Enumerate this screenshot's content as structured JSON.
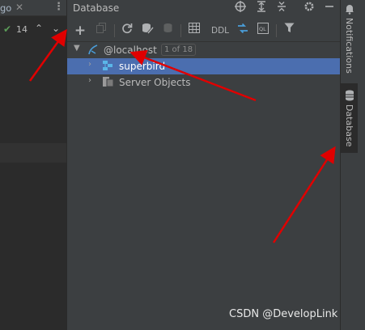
{
  "left_panel": {
    "tab_fragment": "go",
    "close_glyph": "✕",
    "menu_glyph": "⋮",
    "checks_glyph": "✔",
    "problem_count": "14",
    "up_glyph": "⌃",
    "down_glyph": "⌄"
  },
  "database_panel": {
    "title": "Database",
    "header_buttons": [
      "crosshair-icon",
      "expand-all-icon",
      "collapse-all-icon",
      "gear-icon",
      "minimize-icon"
    ],
    "toolbar": {
      "add_glyph": "+",
      "ddl_label": "DDL"
    },
    "tree": [
      {
        "label": "@localhost",
        "badge": "1 of 18",
        "expanded": true,
        "depth": 0,
        "icon": "datasource-icon"
      },
      {
        "label": "superbird",
        "expanded": false,
        "depth": 1,
        "selected": true,
        "icon": "schema-icon"
      },
      {
        "label": "Server Objects",
        "expanded": false,
        "depth": 1,
        "icon": "server-objects-icon"
      }
    ]
  },
  "tool_stripe": {
    "notifications_label": "Notifications",
    "database_label": "Database"
  },
  "watermark": "CSDN @DevelopLink",
  "colors": {
    "panel_bg": "#3c3f41",
    "editor_bg": "#2b2b2b",
    "selection": "#4b6eaf",
    "annotation_arrow": "#e00000"
  }
}
